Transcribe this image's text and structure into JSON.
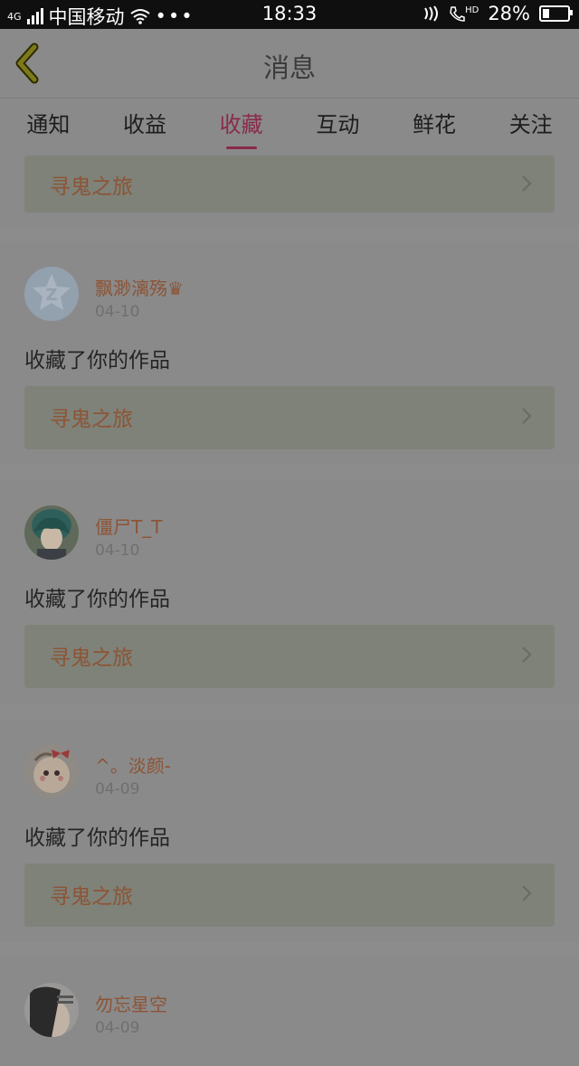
{
  "status": {
    "carrier": "中国移动",
    "network": "4G",
    "time": "18:33",
    "call_badge": "HD",
    "battery": "28%"
  },
  "header": {
    "title": "消息"
  },
  "tabs": [
    {
      "label": "通知"
    },
    {
      "label": "收益"
    },
    {
      "label": "收藏",
      "active": true
    },
    {
      "label": "互动"
    },
    {
      "label": "鲜花"
    },
    {
      "label": "关注"
    }
  ],
  "feed": [
    {
      "work_title": "寻鬼之旅"
    },
    {
      "username": "飘渺漓殇♛",
      "date": "04-10",
      "action": "收藏了你的作品",
      "work_title": "寻鬼之旅"
    },
    {
      "username": "僵尸T_T",
      "date": "04-10",
      "action": "收藏了你的作品",
      "work_title": "寻鬼之旅"
    },
    {
      "username": "^。淡颜-",
      "date": "04-09",
      "action": "收藏了你的作品",
      "work_title": "寻鬼之旅"
    },
    {
      "username": "勿忘星空",
      "date": "04-09"
    }
  ],
  "colors": {
    "accent": "#8a2a4a",
    "username": "#8c5436",
    "overlay_bg": "#8a8a8a"
  }
}
